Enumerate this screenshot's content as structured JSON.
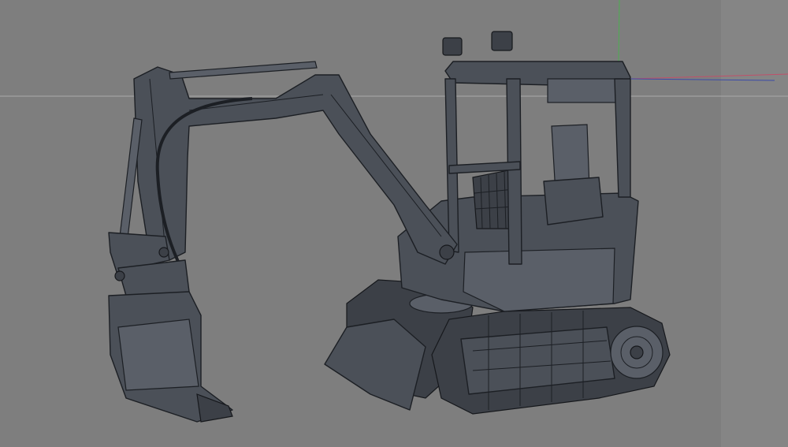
{
  "viewport": {
    "background_color": "#7e7e7e",
    "side_band_color": "#858585",
    "horizon_line_color": "#a9a9a9",
    "model_color": "#4b5058",
    "wire_color": "#1c1f24",
    "axis_colors": {
      "x": "#c0506a",
      "y": "#4caf50",
      "z": "#3a4aa8"
    }
  }
}
